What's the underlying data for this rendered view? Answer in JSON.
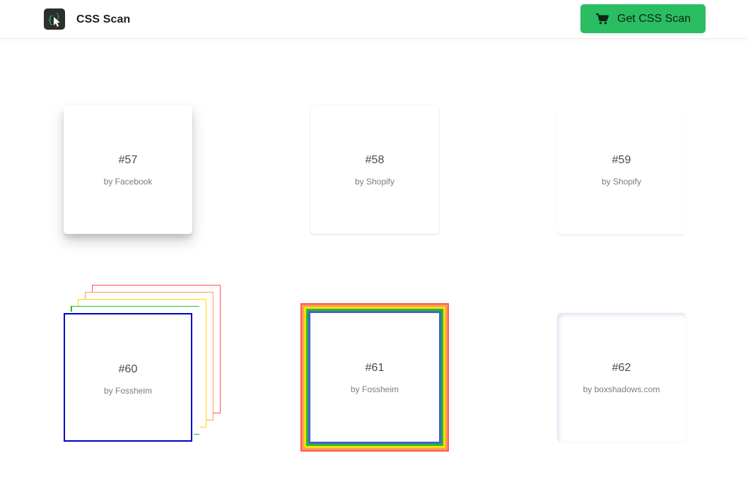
{
  "header": {
    "brand": "CSS Scan",
    "logo_icon": "css-scan-logo-icon",
    "cta_label": "Get CSS Scan",
    "cta_icon": "shopping-cart-icon",
    "cta_color": "#2abd62"
  },
  "cards": [
    {
      "number": "#57",
      "author": "by Facebook"
    },
    {
      "number": "#58",
      "author": "by Shopify"
    },
    {
      "number": "#59",
      "author": "by Shopify"
    },
    {
      "number": "#60",
      "author": "by Fossheim"
    },
    {
      "number": "#61",
      "author": "by Fossheim"
    },
    {
      "number": "#62",
      "author": "by boxshadows.com"
    }
  ],
  "colors": {
    "rainbow": [
      "#ff5555",
      "#ff9c55",
      "#ffd913",
      "#1fc11b",
      "#0000c8"
    ]
  }
}
